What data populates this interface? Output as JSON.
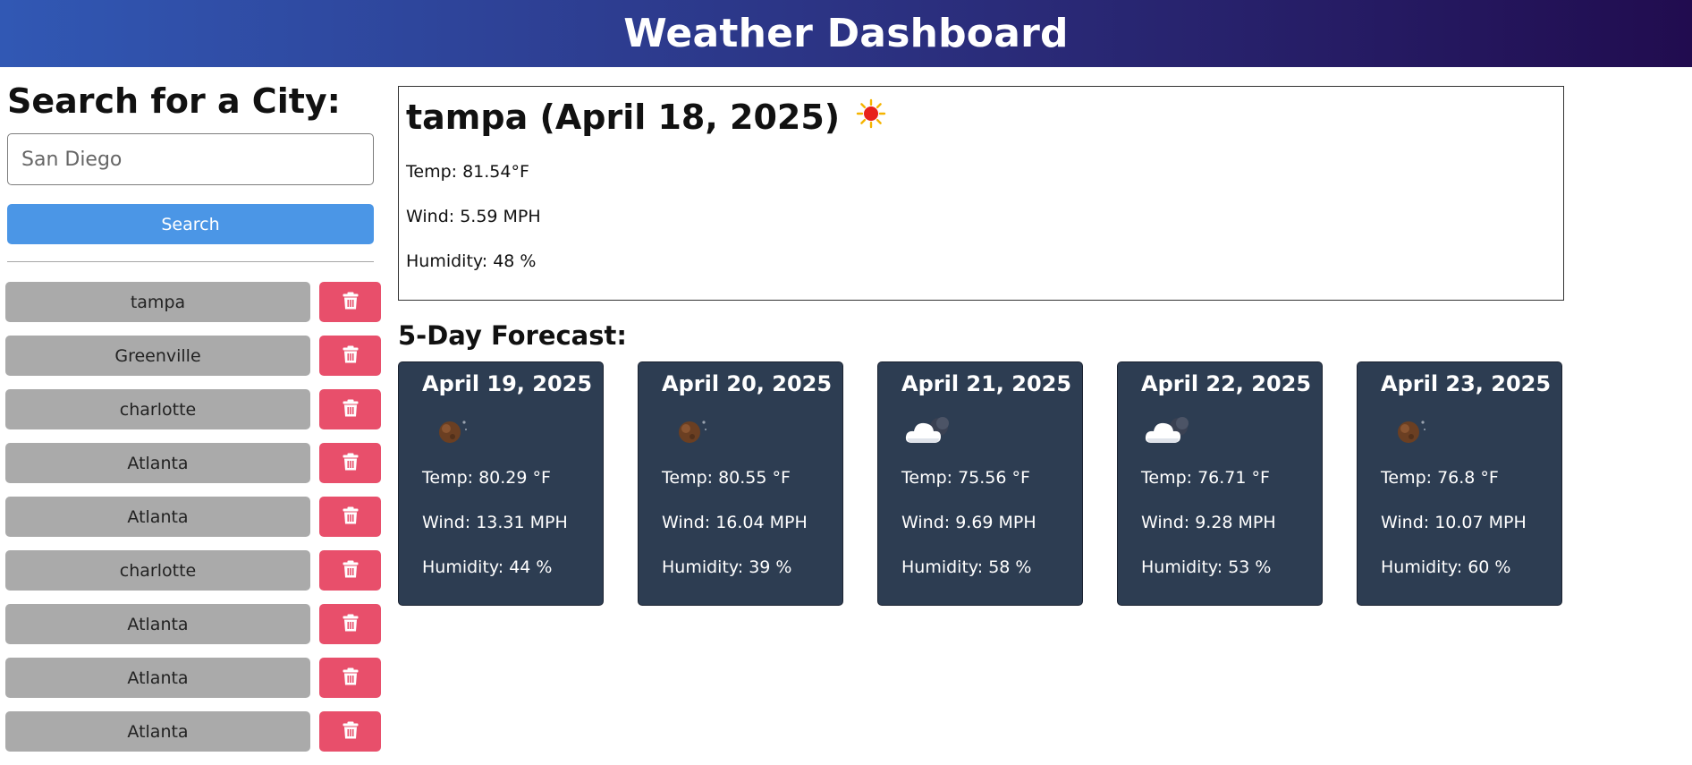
{
  "header": {
    "title": "Weather Dashboard"
  },
  "search": {
    "heading": "Search for a City:",
    "placeholder": "San Diego",
    "value": "",
    "button_label": "Search"
  },
  "history": [
    {
      "city": "tampa"
    },
    {
      "city": "Greenville"
    },
    {
      "city": "charlotte"
    },
    {
      "city": "Atlanta"
    },
    {
      "city": "Atlanta"
    },
    {
      "city": "charlotte"
    },
    {
      "city": "Atlanta"
    },
    {
      "city": "Atlanta"
    },
    {
      "city": "Atlanta"
    }
  ],
  "current": {
    "title": "tampa (April 18, 2025)",
    "icon": "sun-icon",
    "temp": "Temp: 81.54°F",
    "wind": "Wind: 5.59 MPH",
    "humidity": "Humidity: 48 %"
  },
  "forecast": {
    "heading": "5-Day Forecast:",
    "days": [
      {
        "date": "April 19, 2025",
        "icon": "night-clear-icon",
        "temp": "Temp: 80.29 °F",
        "wind": "Wind: 13.31 MPH",
        "humidity": "Humidity: 44 %"
      },
      {
        "date": "April 20, 2025",
        "icon": "night-clear-icon",
        "temp": "Temp: 80.55 °F",
        "wind": "Wind: 16.04 MPH",
        "humidity": "Humidity: 39 %"
      },
      {
        "date": "April 21, 2025",
        "icon": "night-cloud-icon",
        "temp": "Temp: 75.56 °F",
        "wind": "Wind: 9.69 MPH",
        "humidity": "Humidity: 58 %"
      },
      {
        "date": "April 22, 2025",
        "icon": "night-cloud-icon",
        "temp": "Temp: 76.71 °F",
        "wind": "Wind: 9.28 MPH",
        "humidity": "Humidity: 53 %"
      },
      {
        "date": "April 23, 2025",
        "icon": "night-clear-icon",
        "temp": "Temp: 76.8 °F",
        "wind": "Wind: 10.07 MPH",
        "humidity": "Humidity: 60 %"
      }
    ]
  },
  "colors": {
    "header_gradient_start": "#3158b4",
    "header_gradient_end": "#210c4f",
    "search_button": "#4b96e6",
    "history_button": "#aaaaaa",
    "delete_button": "#e84f6b",
    "forecast_card": "#2d3d52"
  }
}
